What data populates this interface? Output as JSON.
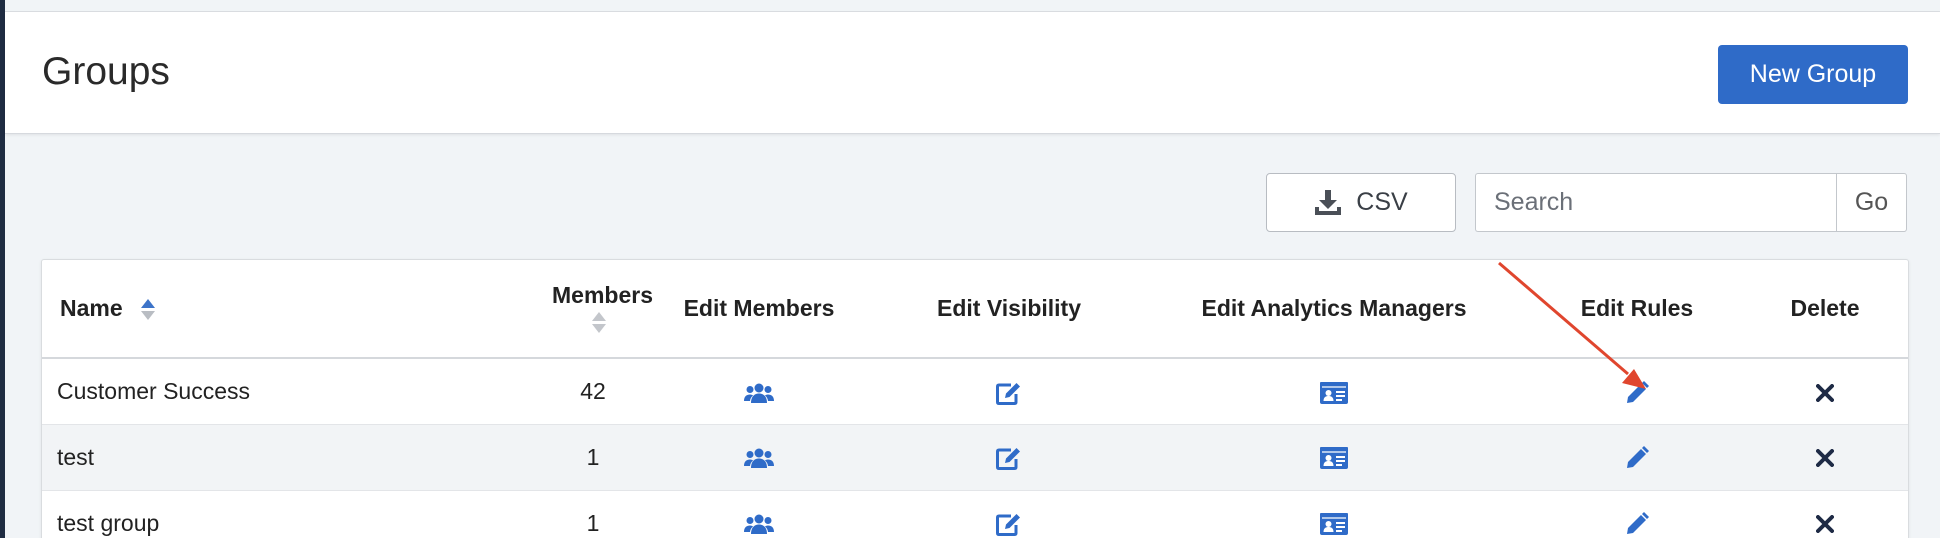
{
  "header": {
    "title": "Groups",
    "new_group_label": "New Group"
  },
  "toolbar": {
    "csv_label": "CSV",
    "search_placeholder": "Search",
    "go_label": "Go"
  },
  "table": {
    "columns": {
      "name": "Name",
      "members": "Members",
      "edit_members": "Edit Members",
      "edit_visibility": "Edit Visibility",
      "edit_analytics_managers": "Edit Analytics Managers",
      "edit_rules": "Edit Rules",
      "delete": "Delete"
    },
    "rows": [
      {
        "name": "Customer Success",
        "members": "42"
      },
      {
        "name": "test",
        "members": "1"
      },
      {
        "name": "test group",
        "members": "1"
      }
    ]
  },
  "colors": {
    "accent": "#2f6bc8",
    "icon_blue": "#2f6bc8",
    "annotation_arrow": "#e0462e",
    "delete_icon": "#1e2a45"
  },
  "icons": {
    "edit_members": "users-icon",
    "edit_visibility": "edit-square-icon",
    "edit_analytics_managers": "id-card-icon",
    "edit_rules": "pencil-icon",
    "delete": "close-icon",
    "csv": "download-icon"
  }
}
